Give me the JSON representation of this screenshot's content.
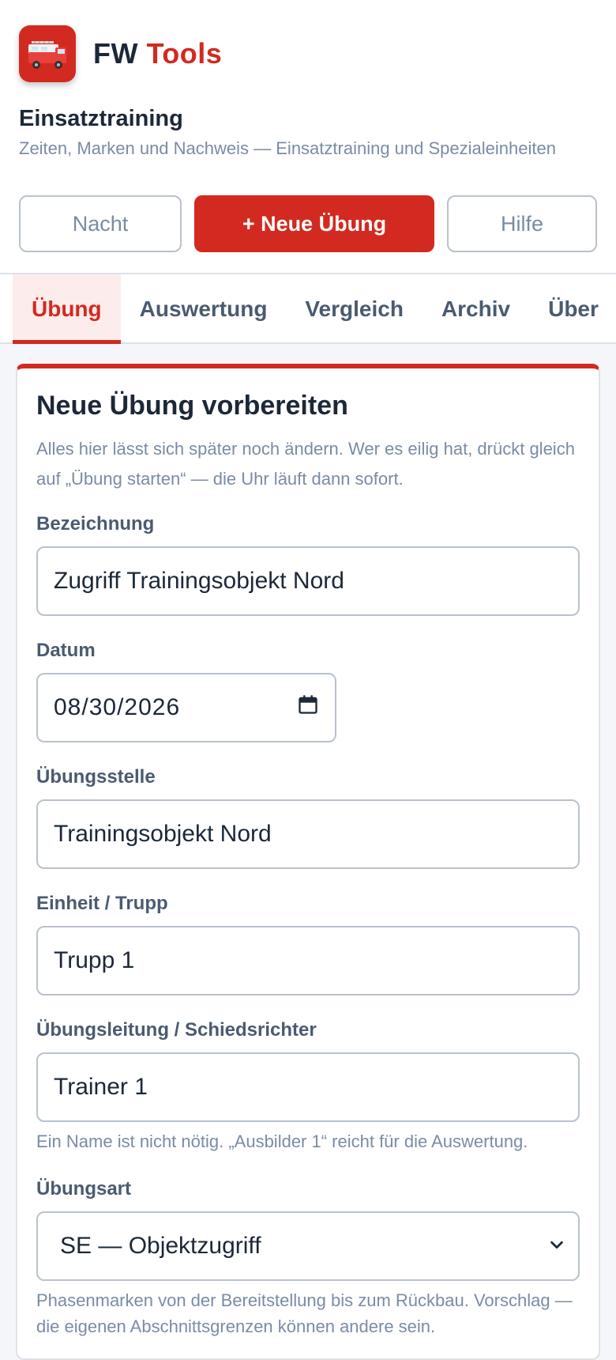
{
  "brand": {
    "part1": "FW",
    "part2": "Tools",
    "accent": "#d22a20"
  },
  "app": {
    "title": "Einsatztraining",
    "subtitle": "Zeiten, Marken und Nachweis — Einsatztraining und Spezialeinheiten"
  },
  "actions": {
    "night": "Nacht",
    "new_exercise": "+ Neue Übung",
    "help": "Hilfe"
  },
  "tabs": [
    {
      "label": "Übung",
      "active": true
    },
    {
      "label": "Auswertung"
    },
    {
      "label": "Vergleich"
    },
    {
      "label": "Archiv"
    },
    {
      "label": "Über"
    }
  ],
  "form": {
    "title": "Neue Übung vorbereiten",
    "intro": "Alles hier lässt sich später noch ändern. Wer es eilig hat, drückt gleich auf „Übung starten“ — die Uhr läuft dann sofort.",
    "name_label": "Bezeichnung",
    "name_value": "Zugriff Trainingsobjekt Nord",
    "date_label": "Datum",
    "date_value": "08/30/2026",
    "location_label": "Übungsstelle",
    "location_value": "Trainingsobjekt Nord",
    "unit_label": "Einheit / Trupp",
    "unit_value": "Trupp 1",
    "lead_label": "Übungsleitung / Schiedsrichter",
    "lead_value": "Trainer 1",
    "lead_hint": "Ein Name ist nicht nötig. „Ausbilder 1“ reicht für die Auswertung.",
    "type_label": "Übungsart",
    "type_value": "SE — Objektzugriff",
    "type_hint": "Phasenmarken von der Bereitstellung bis zum Rückbau. Vorschlag — die eigenen Abschnittsgrenzen können andere sein."
  }
}
